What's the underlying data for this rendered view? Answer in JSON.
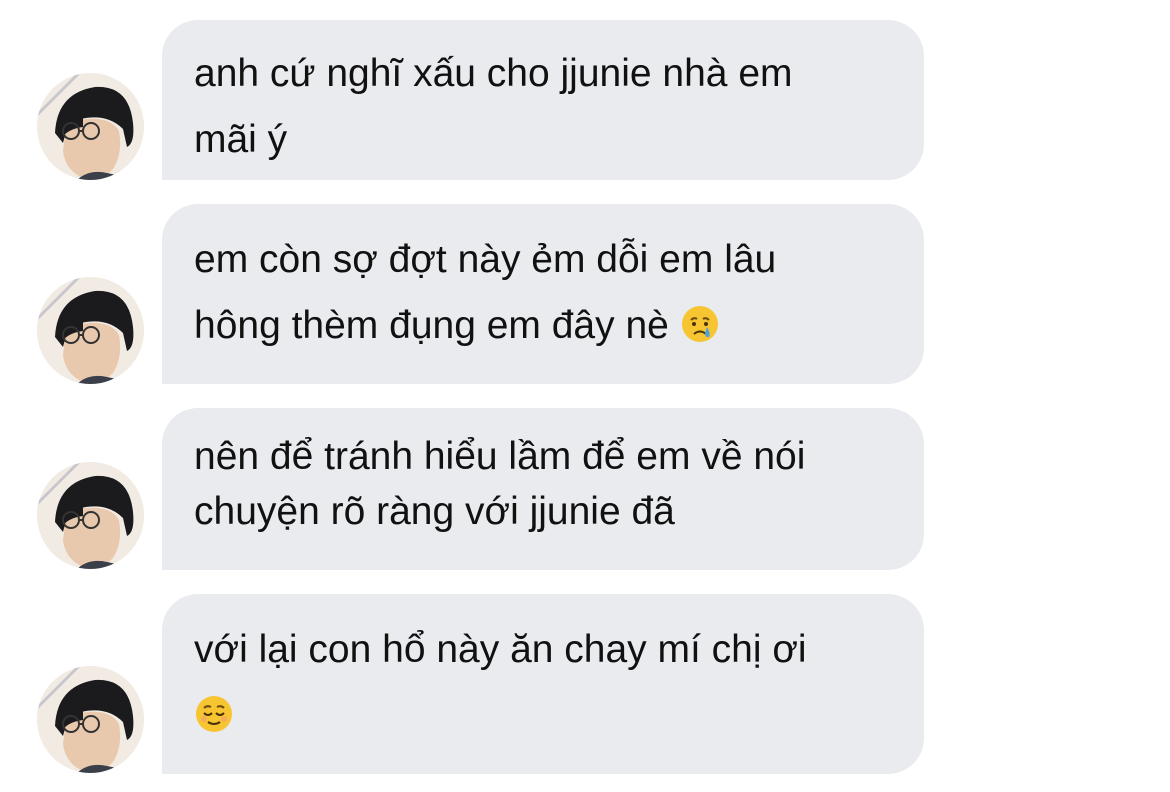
{
  "messages": [
    {
      "lines": [
        "anh cứ nghĩ xấu cho jjunie nhà em",
        "mãi ý"
      ],
      "emoji": null
    },
    {
      "lines": [
        "em còn sợ đợt này ẻm dỗi em lâu",
        "hông thèm đụng em đây nè"
      ],
      "emoji": "crying-face-emoji"
    },
    {
      "lines": [
        "nên để tránh hiểu lầm để em về nói",
        "chuyện rõ ràng với jjunie đã"
      ],
      "emoji": null
    },
    {
      "lines": [
        "với lại con hổ này ăn chay mí chị ơi",
        ""
      ],
      "emoji": "relieved-face-emoji"
    }
  ],
  "colors": {
    "bubble": "#e9ebef",
    "text": "#111111",
    "emoji_face": "#f7c531"
  }
}
